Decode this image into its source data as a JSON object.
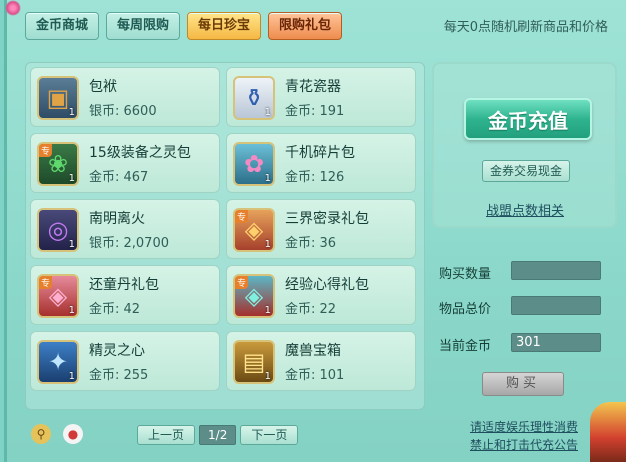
{
  "tabs": [
    {
      "label": "金币商城"
    },
    {
      "label": "每周限购"
    },
    {
      "label": "每日珍宝"
    },
    {
      "label": "限购礼包"
    }
  ],
  "refresh_note": "每天0点随机刷新商品和价格",
  "items": [
    {
      "name": "包袱",
      "price": "银币: 6600",
      "qty": "1",
      "icon": "bag-icon",
      "tag": ""
    },
    {
      "name": "青花瓷器",
      "price": "金币: 191",
      "qty": "1",
      "icon": "porcelain-vase-icon",
      "tag": ""
    },
    {
      "name": "15级装备之灵包",
      "price": "金币: 467",
      "qty": "1",
      "icon": "equipment-spirit-pack-icon",
      "tag": "专"
    },
    {
      "name": "千机碎片包",
      "price": "金币: 126",
      "qty": "1",
      "icon": "fragment-pack-icon",
      "tag": ""
    },
    {
      "name": "南明离火",
      "price": "银币: 2,0700",
      "qty": "1",
      "icon": "fire-ring-icon",
      "tag": ""
    },
    {
      "name": "三界密录礼包",
      "price": "金币: 36",
      "qty": "1",
      "icon": "gift-pouch-icon",
      "tag": "专"
    },
    {
      "name": "还童丹礼包",
      "price": "金币: 42",
      "qty": "1",
      "icon": "gift-pouch-icon",
      "tag": "专"
    },
    {
      "name": "经验心得礼包",
      "price": "金币: 22",
      "qty": "1",
      "icon": "gift-pouch-icon",
      "tag": "专"
    },
    {
      "name": "精灵之心",
      "price": "金币: 255",
      "qty": "1",
      "icon": "spirit-heart-icon",
      "tag": ""
    },
    {
      "name": "魔兽宝箱",
      "price": "金币: 101",
      "qty": "1",
      "icon": "treasure-chest-icon",
      "tag": ""
    }
  ],
  "recharge": {
    "label": "金币充值"
  },
  "exchange": {
    "label": "金券交易现金"
  },
  "alliance": {
    "label": "战盟点数相关"
  },
  "form": {
    "quantity_label": "购买数量",
    "quantity_value": "",
    "total_label": "物品总价",
    "total_value": "",
    "gold_label": "当前金币",
    "gold_value": "301"
  },
  "buy": {
    "label": "购买"
  },
  "pager": {
    "prev": "上一页",
    "page": "1/2",
    "next": "下一页"
  },
  "notice": {
    "line1": "请适度娱乐理性消费",
    "line2": "禁止和打击代充公告"
  }
}
